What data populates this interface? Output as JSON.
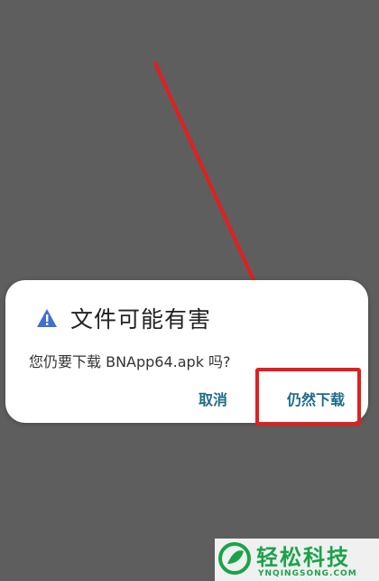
{
  "dialog": {
    "icon": "warning-icon",
    "title": "文件可能有害",
    "message": "您仍要下载 BNApp64.apk 吗?",
    "cancel_label": "取消",
    "download_label": "仍然下载"
  },
  "annotation": {
    "color": "#e21f1f"
  },
  "watermark": {
    "logo": "leaf-logo",
    "text": "轻松科技",
    "subtext": "YNQINGSONG.COM"
  }
}
